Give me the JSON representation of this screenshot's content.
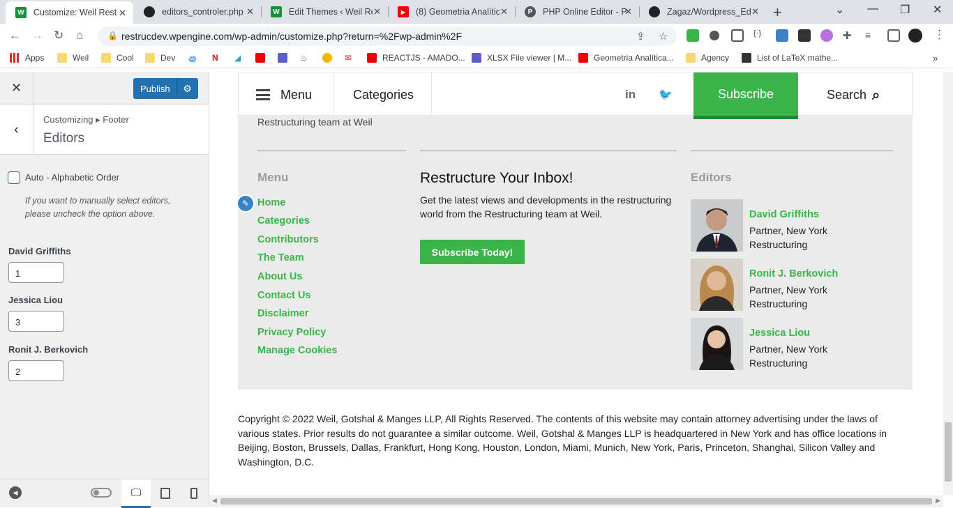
{
  "browser": {
    "tabs": [
      {
        "title": "Customize: Weil Restru",
        "fav": "W",
        "color": "#1a8f3a",
        "active": true
      },
      {
        "title": "editors_controler.php",
        "fav": "◎",
        "color": "#222",
        "active": false
      },
      {
        "title": "Edit Themes ‹ Weil Re",
        "fav": "W",
        "color": "#1a8f3a",
        "active": false
      },
      {
        "title": "(8) Geometria Analític",
        "fav": "▶",
        "color": "#e00",
        "active": false
      },
      {
        "title": "PHP Online Editor - Ph",
        "fav": "P",
        "color": "#555",
        "active": false
      },
      {
        "title": "Zagaz/Wordpress_Edit",
        "fav": "◉",
        "color": "#222",
        "active": false
      }
    ],
    "url": "restrucdev.wpengine.com/wp-admin/customize.php?return=%2Fwp-admin%2F",
    "bookmarks": [
      {
        "label": "Apps",
        "type": "apps"
      },
      {
        "label": "Weil",
        "type": "folder"
      },
      {
        "label": "Cool",
        "type": "folder"
      },
      {
        "label": "Dev",
        "type": "folder"
      },
      {
        "label": "REACTJS - AMADO...",
        "type": "youtube"
      },
      {
        "label": "XLSX File viewer | M...",
        "type": "teams"
      },
      {
        "label": "Geometria Analítica...",
        "type": "youtube"
      },
      {
        "label": "Agency",
        "type": "folder"
      },
      {
        "label": "List of LaTeX mathe...",
        "type": "oeis"
      }
    ]
  },
  "customizer": {
    "publish_label": "Publish",
    "breadcrumb": "Customizing ▸ Footer",
    "section_title": "Editors",
    "checkbox_label": "Auto - Alphabetic Order",
    "hint": "If you want to manually select editors, please uncheck the option above.",
    "fields": [
      {
        "label": "David Griffiths",
        "value": "1"
      },
      {
        "label": "Jessica Liou",
        "value": "3"
      },
      {
        "label": "Ronit J. Berkovich",
        "value": "2"
      }
    ]
  },
  "site": {
    "nav": {
      "menu": "Menu",
      "categories": "Categories",
      "subscribe": "Subscribe",
      "search": "Search"
    },
    "partial_text": "Restructuring team at Weil",
    "menu_heading": "Menu",
    "menu_items": [
      "Home",
      "Categories",
      "Contributors",
      "The Team",
      "About Us",
      "Contact Us",
      "Disclaimer",
      "Privacy Policy",
      "Manage Cookies"
    ],
    "inbox": {
      "title": "Restructure Your Inbox!",
      "text": "Get the latest views and developments in the restructuring world from the Restructuring team at Weil.",
      "button": "Subscribe Today!"
    },
    "editors_heading": "Editors",
    "editors": [
      {
        "name": "David Griffiths",
        "role1": "Partner, New York",
        "role2": "Restructuring"
      },
      {
        "name": "Ronit J. Berkovich",
        "role1": "Partner, New York",
        "role2": "Restructuring"
      },
      {
        "name": "Jessica Liou",
        "role1": "Partner, New York",
        "role2": "Restructuring"
      }
    ],
    "copyright": "Copyright © 2022 Weil, Gotshal & Manges LLP, All Rights Reserved. The contents of this website may contain attorney advertising under the laws of various states. Prior results do not guarantee a similar outcome. Weil, Gotshal & Manges LLP is headquartered in New York and has office locations in Beijing, Boston, Brussels, Dallas, Frankfurt, Hong Kong, Houston, London, Miami, Munich, New York, Paris, Princeton, Shanghai, Silicon Valley and Washington, D.C."
  },
  "colors": {
    "accent_green": "#3ab54a",
    "wp_blue": "#2271b1"
  }
}
